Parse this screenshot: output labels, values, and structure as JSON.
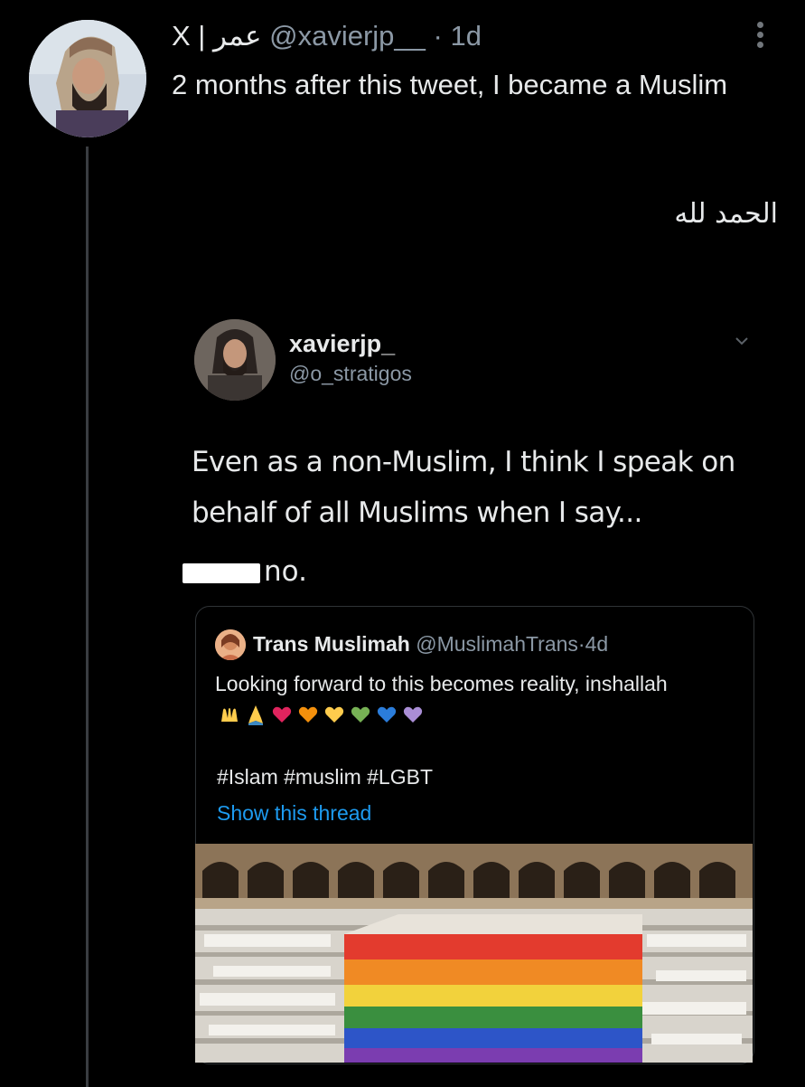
{
  "tweet": {
    "display_name": "X | عمر",
    "handle": "@xavierjp__",
    "separator": "·",
    "time": "1d",
    "text": "2 months after this tweet, I became a Muslim",
    "arabic_line": "الحمد لله"
  },
  "embedded_tweet": {
    "name": "xavierjp_",
    "handle": "@o_stratigos",
    "text": "Even as a non-Muslim, I think I speak on behalf of all Muslims when I say...",
    "censored_suffix": "no."
  },
  "quoted_tweet": {
    "name": "Trans Muslimah",
    "handle": "@MuslimahTrans",
    "separator": "·",
    "time": "4d",
    "text": "Looking forward to this becomes reality, inshallah",
    "emojis": [
      "open-hands",
      "folded-hands",
      "red-heart",
      "orange-heart",
      "yellow-heart",
      "green-heart",
      "blue-heart",
      "purple-heart"
    ],
    "hashtags": "#Islam #muslim #LGBT",
    "show_thread": "Show this thread"
  },
  "colors": {
    "background": "#000000",
    "text_primary": "#e7e9ea",
    "text_secondary": "#8b98a5",
    "link_blue": "#1d9bf0",
    "heart_red": "#e0245e",
    "heart_orange": "#f4900c",
    "heart_yellow": "#ffcc4d",
    "heart_green": "#77b255",
    "heart_blue": "#2b7ddb",
    "heart_purple": "#aa8ed6"
  }
}
